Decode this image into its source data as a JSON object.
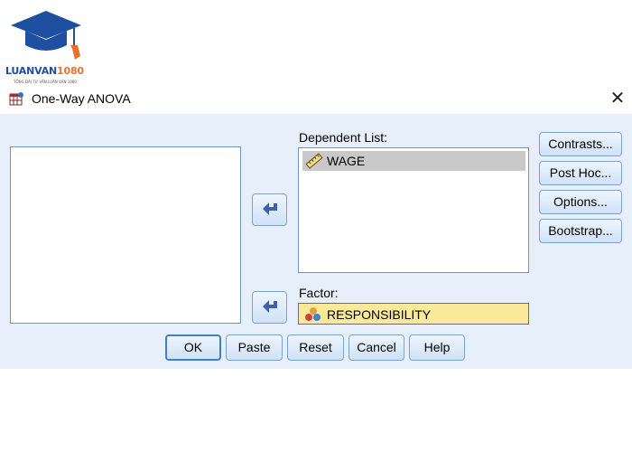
{
  "logo": {
    "brand_part1": "LUANVAN",
    "brand_part2": "1080",
    "tagline": "TỔNG ĐÀI TƯ VẤN LUẬN VĂN 1080"
  },
  "window": {
    "title": "One-Way ANOVA",
    "close_glyph": "✕",
    "app_icon": "spss-table-icon"
  },
  "variable_list": {
    "items": []
  },
  "dependent_list": {
    "label": "Dependent List:",
    "items": [
      {
        "label": "WAGE",
        "icon": "scale-ruler-icon"
      }
    ]
  },
  "factor": {
    "label": "Factor:",
    "value": "RESPONSIBILITY",
    "icon": "nominal-variable-icon"
  },
  "side_buttons": {
    "contrasts": "Contrasts...",
    "post_hoc": "Post Hoc...",
    "options": "Options...",
    "bootstrap": "Bootstrap..."
  },
  "bottom_buttons": {
    "ok": "OK",
    "paste": "Paste",
    "reset": "Reset",
    "cancel": "Cancel",
    "help": "Help"
  },
  "colors": {
    "dialog_bg": "#e7f0fa",
    "factor_bg": "#fbe99a",
    "selected_item_bg": "#c9c9c9",
    "brand_blue": "#1f4fa1",
    "brand_orange": "#e8722a"
  }
}
